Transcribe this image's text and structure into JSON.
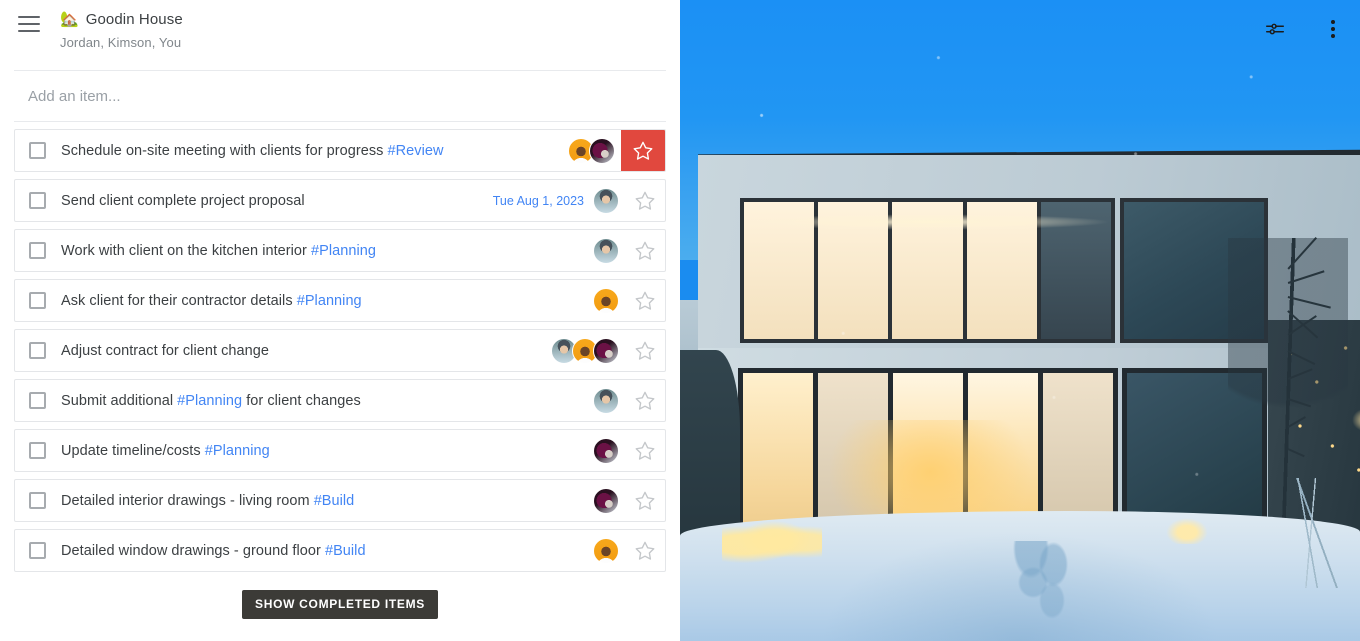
{
  "header": {
    "menu_icon": "hamburger-menu-icon",
    "emoji": "🏡",
    "title": "Goodin House",
    "members": "Jordan, Kimson, You"
  },
  "add_item": {
    "placeholder": "Add an item...",
    "value": ""
  },
  "tasks": [
    {
      "text_before": "Schedule on-site meeting with clients for progress ",
      "tag": "#Review",
      "text_after": "",
      "date": "",
      "avatars": [
        "av-orange",
        "av-magenta"
      ],
      "star_active": true,
      "checked": false
    },
    {
      "text_before": "Send client complete project proposal",
      "tag": "",
      "text_after": "",
      "date": "Tue Aug 1, 2023",
      "avatars": [
        "av-teal"
      ],
      "star_active": false,
      "checked": false
    },
    {
      "text_before": "Work with client on the kitchen interior ",
      "tag": "#Planning",
      "text_after": "",
      "date": "",
      "avatars": [
        "av-teal"
      ],
      "star_active": false,
      "checked": false
    },
    {
      "text_before": "Ask client for their contractor details ",
      "tag": "#Planning",
      "text_after": "",
      "date": "",
      "avatars": [
        "av-orange"
      ],
      "star_active": false,
      "checked": false
    },
    {
      "text_before": "Adjust contract for client change",
      "tag": "",
      "text_after": "",
      "date": "",
      "avatars": [
        "av-teal",
        "av-orange",
        "av-magenta"
      ],
      "star_active": false,
      "checked": false
    },
    {
      "text_before": "Submit additional ",
      "tag": "#Planning",
      "text_after": " for client changes",
      "date": "",
      "avatars": [
        "av-teal"
      ],
      "star_active": false,
      "checked": false
    },
    {
      "text_before": "Update timeline/costs ",
      "tag": "#Planning",
      "text_after": "",
      "date": "",
      "avatars": [
        "av-magenta"
      ],
      "star_active": false,
      "checked": false
    },
    {
      "text_before": "Detailed interior drawings - living room ",
      "tag": "#Build",
      "text_after": "",
      "date": "",
      "avatars": [
        "av-magenta"
      ],
      "star_active": false,
      "checked": false
    },
    {
      "text_before": "Detailed window drawings - ground floor ",
      "tag": "#Build",
      "text_after": "",
      "date": "",
      "avatars": [
        "av-orange"
      ],
      "star_active": false,
      "checked": false
    }
  ],
  "footer": {
    "show_completed_label": "SHOW COMPLETED ITEMS"
  },
  "photo_actions": {
    "tune_icon": "tune-sliders-icon",
    "more_icon": "more-vertical-icon"
  },
  "colors": {
    "accent_blue": "#4285f4",
    "star_active_bg": "#e1483e",
    "text_primary": "#3c4043",
    "text_secondary": "#80868b",
    "button_dark": "#3c3b37",
    "sky_blue": "#2196f3"
  },
  "photo": {
    "alt": "Modern two-storey house at dusk with lit windows and snow-covered garden"
  }
}
